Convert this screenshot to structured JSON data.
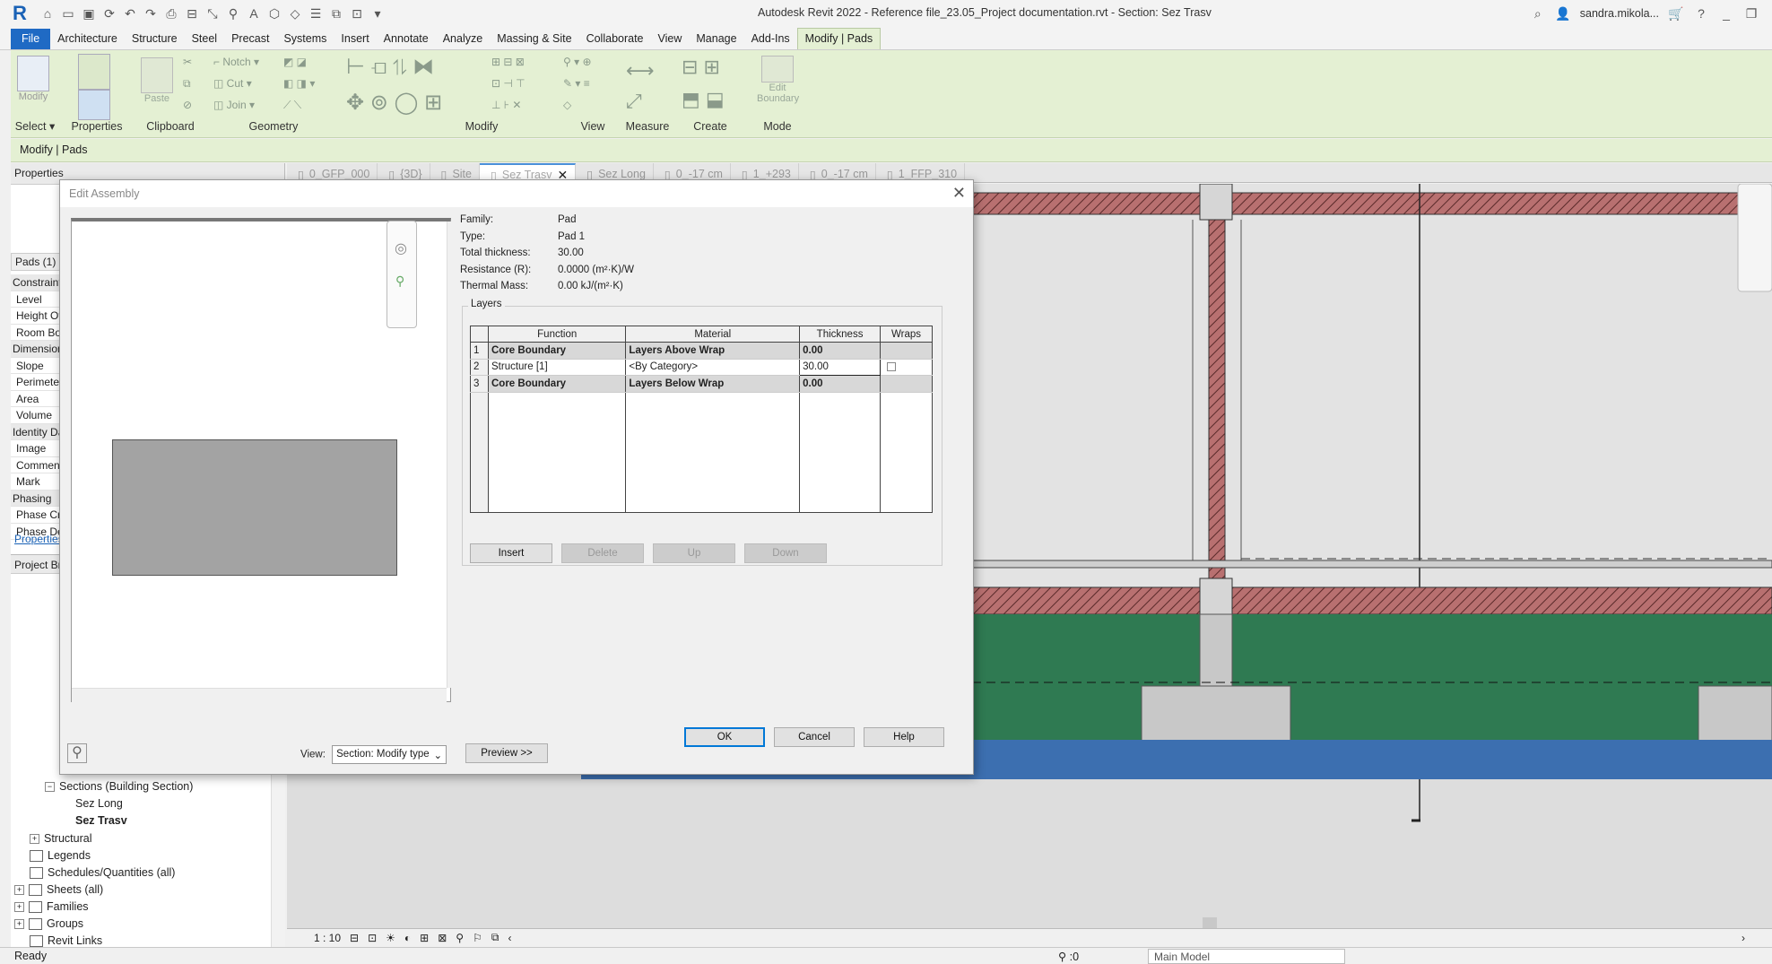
{
  "app": {
    "title": "Autodesk Revit 2022 - Reference file_23.05_Project documentation.rvt - Section: Sez Trasv",
    "user": "sandra.mikola...",
    "logo_letter": "R",
    "accent": "#1f6ac4",
    "ribbon_color": "#e4f0d3"
  },
  "ribbon_tabs": [
    "File",
    "Architecture",
    "Structure",
    "Steel",
    "Precast",
    "Systems",
    "Insert",
    "Annotate",
    "Analyze",
    "Massing & Site",
    "Collaborate",
    "View",
    "Manage",
    "Add-Ins",
    "Modify | Pads"
  ],
  "ribbon": {
    "select_label": "Select",
    "modify_label": "Modify",
    "properties_label": "Properties",
    "paste_label": "Paste",
    "clipboard_label": "Clipboard",
    "notch_label": "Notch",
    "cut_label": "Cut",
    "join_label": "Join",
    "geometry_label": "Geometry",
    "modify_group_label": "Modify",
    "view_label": "View",
    "measure_label": "Measure",
    "create_label": "Create",
    "edit_boundary_label": "Edit Boundary",
    "mode_label": "Mode"
  },
  "options_bar": {
    "context": "Modify | Pads"
  },
  "properties_panel": {
    "title": "Properties",
    "instance": "Pads (1)",
    "rows": [
      {
        "label": "Constraints",
        "section": true
      },
      {
        "label": "Level"
      },
      {
        "label": "Height Offset"
      },
      {
        "label": "Room Bounding"
      },
      {
        "label": "Dimensions",
        "section": true
      },
      {
        "label": "Slope"
      },
      {
        "label": "Perimeter"
      },
      {
        "label": "Area"
      },
      {
        "label": "Volume"
      },
      {
        "label": "Identity Data",
        "section": true
      },
      {
        "label": "Image"
      },
      {
        "label": "Comments"
      },
      {
        "label": "Mark"
      },
      {
        "label": "Phasing",
        "section": true
      },
      {
        "label": "Phase Created"
      },
      {
        "label": "Phase Demolished"
      }
    ],
    "help_link": "Properties help",
    "browser_title": "Project Browser"
  },
  "project_browser": {
    "items": [
      {
        "label": "Sections (Building Section)",
        "indent": 2,
        "exp": "-"
      },
      {
        "label": "Sez Long",
        "indent": 4
      },
      {
        "label": "Sez Trasv",
        "indent": 4,
        "bold": true
      },
      {
        "label": "Structural",
        "indent": 1,
        "exp": "+"
      },
      {
        "label": "Legends",
        "indent": 1,
        "icon": true
      },
      {
        "label": "Schedules/Quantities (all)",
        "indent": 1,
        "icon": true
      },
      {
        "label": "Sheets (all)",
        "indent": 0,
        "exp": "+",
        "icon": true
      },
      {
        "label": "Families",
        "indent": 0,
        "exp": "+",
        "icon": true
      },
      {
        "label": "Groups",
        "indent": 0,
        "exp": "+",
        "icon": true
      },
      {
        "label": "Revit Links",
        "indent": 1,
        "icon": true
      }
    ]
  },
  "view_tabs": [
    {
      "label": "0_GFP_000"
    },
    {
      "label": "{3D}"
    },
    {
      "label": "Site"
    },
    {
      "label": "Sez Trasv",
      "active": true
    },
    {
      "label": "Sez Long"
    },
    {
      "label": "0_-17 cm"
    },
    {
      "label": "1_+293"
    },
    {
      "label": "0_-17 cm"
    },
    {
      "label": "1_FFP_310"
    }
  ],
  "view_bar": {
    "scale": "1 : 10"
  },
  "status": {
    "text": "Ready",
    "filter_count": ":0",
    "model": "Main Model"
  },
  "dialog": {
    "title": "Edit Assembly",
    "props": [
      {
        "k": "Family:",
        "v": "Pad"
      },
      {
        "k": "Type:",
        "v": "Pad 1"
      },
      {
        "k": "Total thickness:",
        "v": "30.00"
      },
      {
        "k": "Resistance (R):",
        "v": "0.0000 (m²·K)/W"
      },
      {
        "k": "Thermal Mass:",
        "v": "0.00 kJ/(m²·K)"
      }
    ],
    "layers_label": "Layers",
    "columns": [
      "Function",
      "Material",
      "Thickness",
      "Wraps"
    ],
    "rows": [
      {
        "num": "1",
        "function": "Core Boundary",
        "material": "Layers Above Wrap",
        "thickness": "0.00",
        "core": true
      },
      {
        "num": "2",
        "function": "Structure [1]",
        "material": "<By Category>",
        "thickness": "30.00",
        "core": false
      },
      {
        "num": "3",
        "function": "Core Boundary",
        "material": "Layers Below Wrap",
        "thickness": "0.00",
        "core": true
      }
    ],
    "buttons": {
      "insert": "Insert",
      "delete": "Delete",
      "up": "Up",
      "down": "Down",
      "ok": "OK",
      "cancel": "Cancel",
      "help": "Help",
      "preview": "Preview >>"
    },
    "view_label": "View:",
    "view_value": "Section: Modify type"
  }
}
